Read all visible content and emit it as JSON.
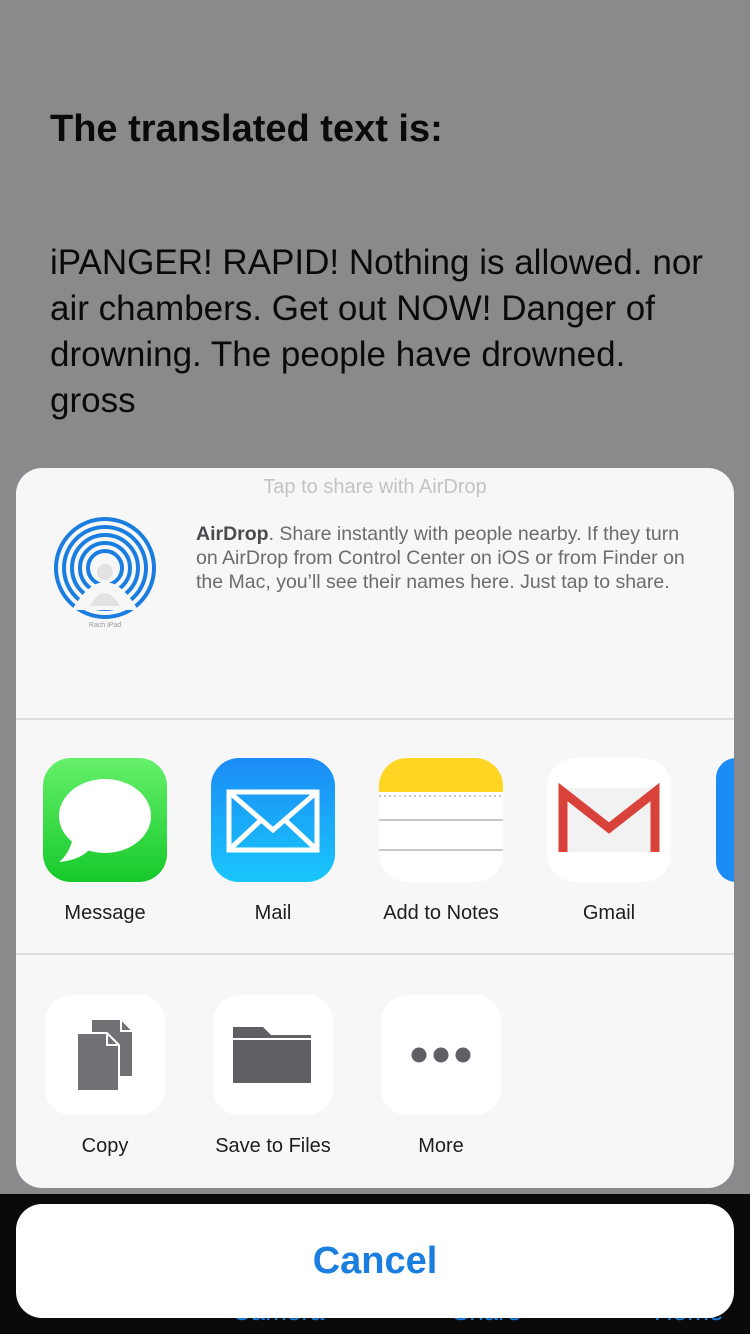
{
  "background": {
    "heading": "The translated text is:",
    "body": "iPANGER! RAPID! Nothing is allowed. nor air chambers. Get out NOW! Danger of drowning. The people have drowned. gross",
    "tabs": [
      "Camera",
      "Share",
      "Home"
    ]
  },
  "share_sheet": {
    "airdrop_hint": "Tap to share with AirDrop",
    "airdrop_title": "AirDrop",
    "airdrop_description": ". Share instantly with people nearby. If they turn on AirDrop from Control Center on iOS or from Finder on the Mac, you’ll see their names here. Just tap to share.",
    "airdrop_device_label": "Rach iPad",
    "apps": [
      {
        "label": "Message",
        "icon": "messages-icon"
      },
      {
        "label": "Mail",
        "icon": "mail-icon"
      },
      {
        "label": "Add to Notes",
        "icon": "notes-icon"
      },
      {
        "label": "Gmail",
        "icon": "gmail-icon"
      }
    ],
    "actions": [
      {
        "label": "Copy",
        "icon": "copy-icon"
      },
      {
        "label": "Save to Files",
        "icon": "folder-icon"
      },
      {
        "label": "More",
        "icon": "more-icon"
      }
    ]
  },
  "cancel_label": "Cancel",
  "colors": {
    "accent": "#1a7ee0",
    "dim_background": "#8a8a8c",
    "sheet": "#f7f7f7"
  }
}
